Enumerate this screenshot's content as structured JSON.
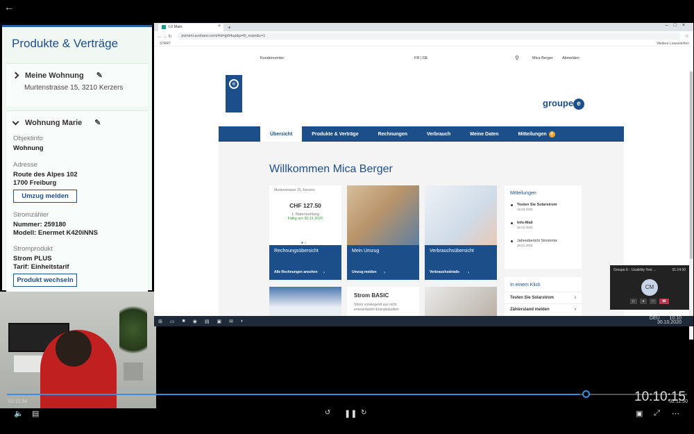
{
  "left_panel": {
    "title": "Produkte & Verträge",
    "wohnung1": {
      "name": "Meine Wohnung",
      "address": "Murtenstrasse 15, 3210 Kerzers"
    },
    "wohnung2": {
      "name": "Wohnung Marie",
      "objekt_label": "Objektinfo",
      "objekt_value": "Wohnung",
      "adresse_label": "Adresse",
      "adresse_line1": "Route des Alpes 102",
      "adresse_line2": "1700 Freiburg",
      "move_button": "Umzug melden",
      "zaehler_label": "Stromzähler",
      "zaehler_nummer": "Nummer:  259180",
      "zaehler_modell": "Modell:   Enermet K420iNNS",
      "produkt_label": "Stromprodukt",
      "produkt_name": "Strom PLUS",
      "produkt_tarif": "Tarif: Einheitstarif",
      "product_button": "Produkt wechseln"
    }
  },
  "browser": {
    "tab_title": "L0 Main",
    "url": "pvmiml.avshare.com/#id=jp04up&p=l0_main&c=1",
    "bookmark": "START",
    "other_bookmarks": "Weitere Lesezeichen"
  },
  "site": {
    "kundencenter": "Kundencenter",
    "lang": "FR | DE",
    "user": "Mica Berger",
    "logout": "Abmelden",
    "brand": "groupe",
    "brand_e": "e",
    "nav": [
      "Übersicht",
      "Produkte & Verträge",
      "Rechnungen",
      "Verbrauch",
      "Meine Daten",
      "Mitteilungen"
    ],
    "nav_badge": "2",
    "welcome": "Willkommen Mica Berger",
    "bill": {
      "address": "Murtenstrasse 15, Kerzers",
      "amount": "CHF 127.50",
      "type": "1. Ratenzahlung",
      "due": "Fällig am 30.11.2020"
    },
    "tiles": [
      {
        "title": "Rechnungsübersicht",
        "link": "Alle Rechnungen ansehen"
      },
      {
        "title": "Mein Umzug",
        "link": "Umzug melden"
      },
      {
        "title": "Verbrauchsübersicht",
        "link": "Verbrauchsdetails"
      }
    ],
    "strom": {
      "title": "Strom BASIC",
      "text": "Strom vorwiegend aus nicht erneuerbaren Energiequellen"
    },
    "messages": {
      "title": "Mitteilungen",
      "items": [
        {
          "title": "Testen Sie Solarstrom",
          "date": "18.02.2020"
        },
        {
          "title": "Info-Mail",
          "date": "30.01.2020"
        },
        {
          "title": "Jahresbericht Strommix",
          "date": "30.01.2020"
        }
      ]
    },
    "quick": {
      "title": "In einem Klick",
      "items": [
        "Testen Sie Solarstrom",
        "Zählerstand melden"
      ]
    }
  },
  "teams": {
    "title": "Groupe E - Usability-Test ...",
    "time": "01:14:30",
    "initials": "CM"
  },
  "taskbar": {
    "lang": "DEU",
    "time": "10:10",
    "date": "30.10.2020"
  },
  "player": {
    "elapsed": "01:11:34",
    "remaining": "-02:11:50",
    "clock": "10:10:15",
    "progress": 0.83
  }
}
